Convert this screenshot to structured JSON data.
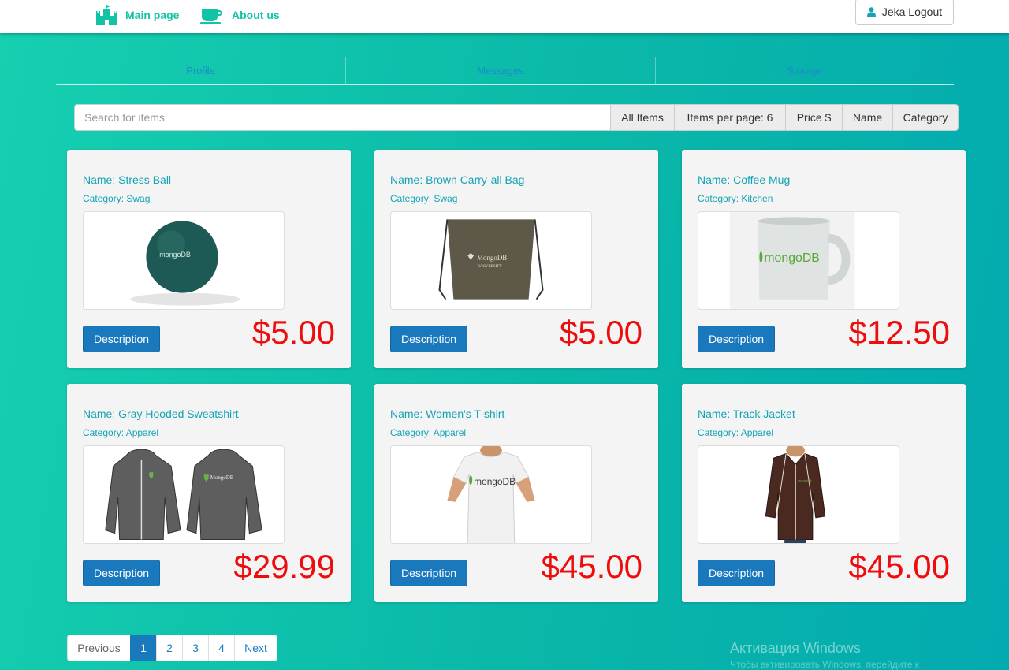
{
  "nav": {
    "main_page": "Main page",
    "about_us": "About us",
    "user_button": "Jeka Logout",
    "brand_color": "#13c3a6"
  },
  "tabs": [
    "Profile",
    "Messages",
    "Storage"
  ],
  "search": {
    "placeholder": "Search for items",
    "value": "",
    "buttons": [
      "All Items",
      "Items per page: 6",
      "Price $",
      "Name",
      "Category"
    ]
  },
  "items": [
    {
      "name": "Name: Stress Ball",
      "category": "Category: Swag",
      "image_icon": "stress-ball-image",
      "button": "Description",
      "price": "$5.00"
    },
    {
      "name": "Name: Brown Carry-all Bag",
      "category": "Category: Swag",
      "image_icon": "carry-all-bag-image",
      "button": "Description",
      "price": "$5.00"
    },
    {
      "name": "Name: Coffee Mug",
      "category": "Category: Kitchen",
      "image_icon": "coffee-mug-image",
      "button": "Description",
      "price": "$12.50"
    },
    {
      "name": "Name: Gray Hooded Sweatshirt",
      "category": "Category: Apparel",
      "image_icon": "hooded-sweatshirt-image",
      "button": "Description",
      "price": "$29.99"
    },
    {
      "name": "Name: Women's T-shirt",
      "category": "Category: Apparel",
      "image_icon": "tshirt-image",
      "button": "Description",
      "price": "$45.00"
    },
    {
      "name": "Name: Track Jacket",
      "category": "Category: Apparel",
      "image_icon": "track-jacket-image",
      "button": "Description",
      "price": "$45.00"
    }
  ],
  "pagination": {
    "previous": "Previous",
    "pages": [
      "1",
      "2",
      "3",
      "4"
    ],
    "active_page": "1",
    "next": "Next"
  },
  "watermark": {
    "title": "Активация Windows",
    "subtitle": "Чтобы активировать Windows, перейдите к"
  },
  "colors": {
    "price": "#ee0d0d",
    "button": "#1a78bd",
    "text_accent": "#13a3b5"
  }
}
